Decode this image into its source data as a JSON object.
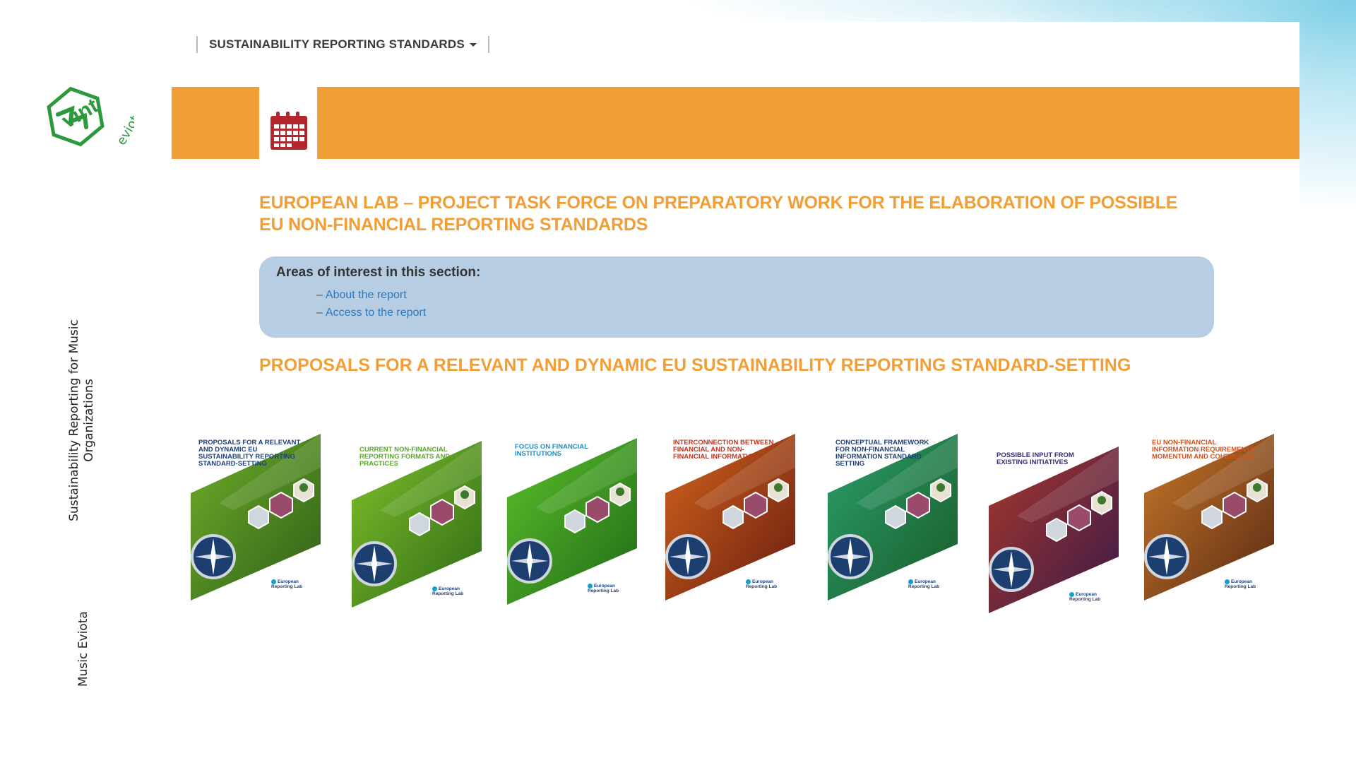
{
  "nav": {
    "items": [
      {
        "label": "SUSTAINABILITY REPORTING STANDARDS"
      }
    ]
  },
  "logo": {
    "text_main": "vint",
    "text_sub": "eviota"
  },
  "sidebar": {
    "line1": "Sustainability Reporting for Music",
    "line2": "Organizations",
    "footer": "Music Eviota"
  },
  "banner": {
    "icon": "calendar-icon",
    "color": "#f19e37",
    "icon_color": "#b5262c"
  },
  "main": {
    "title": "EUROPEAN LAB – PROJECT TASK FORCE ON PREPARATORY WORK FOR THE ELABORATION OF POSSIBLE EU NON-FINANCIAL REPORTING STANDARDS",
    "areas": {
      "heading": "Areas of interest in this section:",
      "links": [
        {
          "label": "About the report"
        },
        {
          "label": "Access to the report"
        }
      ]
    },
    "subtitle": "PROPOSALS FOR A RELEVANT AND DYNAMIC EU SUSTAINABILITY REPORTING STANDARD-SETTING"
  },
  "covers": [
    {
      "title": "PROPOSALS FOR A RELEVANT AND DYNAMIC EU SUSTAINABILITY REPORTING STANDARD-SETTING",
      "title_color": "#1c3f7a",
      "theme": [
        "#6fae2a",
        "#2f5e18"
      ]
    },
    {
      "title": "CURRENT NON-FINANCIAL REPORTING FORMATS AND PRACTICES",
      "title_color": "#5aa82a",
      "theme": [
        "#7fc02b",
        "#2e6a16"
      ]
    },
    {
      "title": "FOCUS ON FINANCIAL INSTITUTIONS",
      "title_color": "#1e8fc8",
      "theme": [
        "#5cc02a",
        "#1f6a18"
      ]
    },
    {
      "title": "INTERCONNECTION BETWEEN FINANCIAL AND NON-FINANCIAL INFORMATION",
      "title_color": "#c2361e",
      "theme": [
        "#d2641d",
        "#6a1d10"
      ]
    },
    {
      "title": "CONCEPTUAL FRAMEWORK FOR NON-FINANCIAL INFORMATION STANDARD SETTING",
      "title_color": "#1c3f7a",
      "theme": [
        "#2aa06a",
        "#1a5a2a"
      ]
    },
    {
      "title": "POSSIBLE INPUT FROM EXISTING INITIATIVES",
      "title_color": "#3a2a7a",
      "theme": [
        "#a8382a",
        "#3a1a4a"
      ]
    },
    {
      "title": "EU NON-FINANCIAL INFORMATION REQUIREMENTS MOMENTUM AND COHERENCE",
      "title_color": "#d2521e",
      "theme": [
        "#c8782a",
        "#5a2a14"
      ]
    }
  ],
  "cover_publisher": "European Reporting Lab"
}
